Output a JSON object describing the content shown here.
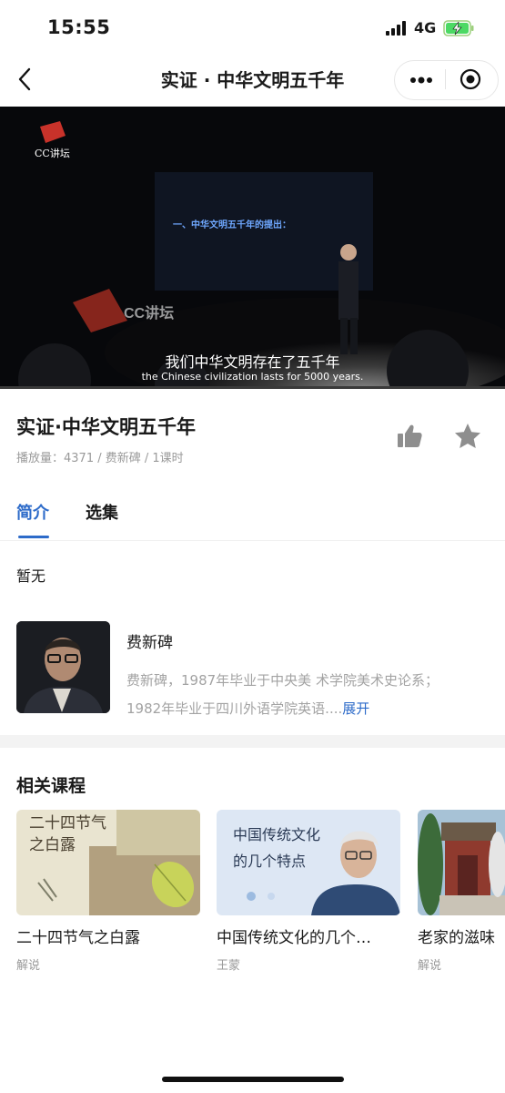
{
  "status_bar": {
    "time": "15:55",
    "network": "4G"
  },
  "nav": {
    "title": "实证 · 中华文明五千年"
  },
  "video": {
    "logo_text": "CC讲坛",
    "slide_text": "一、中华文明五千年的提出：",
    "subtitle_cn": "我们中华文明存在了五千年",
    "subtitle_en": "the Chinese civilization lasts for 5000 years."
  },
  "course": {
    "title": "实证·中华文明五千年",
    "meta": "播放量：4371 / 费新碑 / 1课时"
  },
  "tabs": [
    {
      "label": "简介",
      "active": true
    },
    {
      "label": "选集",
      "active": false
    }
  ],
  "intro": {
    "text": "暂无"
  },
  "author": {
    "name": "费新碑",
    "bio_line1": "费新碑，1987年毕业于中央美 术学院美术史论系；",
    "bio_line2": "1982年毕业于四川外语学院英语....",
    "expand_label": "展开"
  },
  "related": {
    "heading": "相关课程",
    "items": [
      {
        "title": "二十四节气之白露",
        "subtitle": "解说",
        "thumb_text_1": "二十四节气",
        "thumb_text_2": "之白露"
      },
      {
        "title": "中国传统文化的几个…",
        "subtitle": "王蒙",
        "thumb_text_1": "中国传统文化",
        "thumb_text_2": "的几个特点"
      },
      {
        "title": "老家的滋味",
        "subtitle": "解说"
      }
    ]
  },
  "colors": {
    "accent": "#2d6bc9",
    "meta_gray": "#9a9a9a",
    "divider": "#f3f3f3"
  }
}
